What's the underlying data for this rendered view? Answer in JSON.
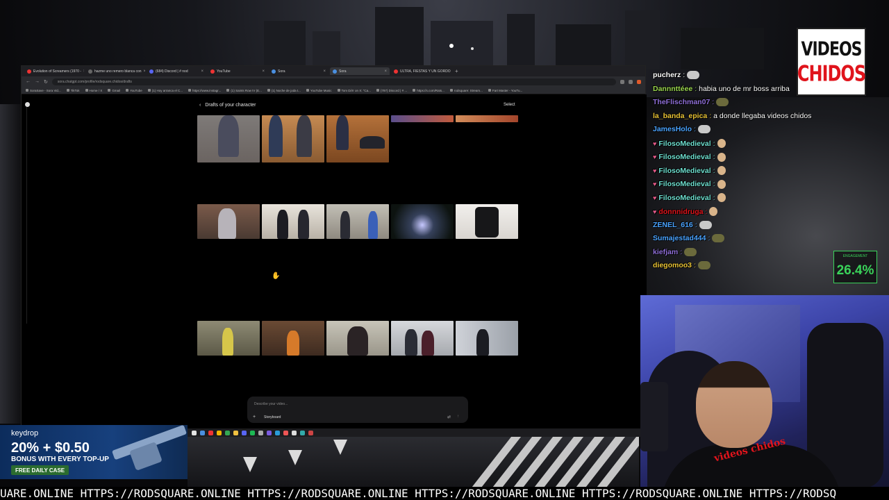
{
  "browser": {
    "tabs": [
      {
        "label": "Evolution of Screamers (1970 -",
        "active": false
      },
      {
        "label": "hazme uno remero blanca con",
        "active": false
      },
      {
        "label": "(684) Discord | # nod",
        "active": false
      },
      {
        "label": "YouTube",
        "active": false
      },
      {
        "label": "Sora",
        "active": false
      },
      {
        "label": "Sora",
        "active": true
      },
      {
        "label": "ULTRA, FIESTAS Y UN GORDO",
        "active": false
      }
    ],
    "url": "sora.chatgpt.com/profile/rodsquare.chidos/drafts",
    "bookmarks": [
      "SoraSave - Sora Vid...",
      "TikTok",
      "Home / X",
      "Gmail",
      "YouTube",
      "(1) Hoy arranca el C...",
      "https://www.instagr...",
      "(1) Saints Row IV (E...",
      "(1) Noche de joda t...",
      "YouTube Music",
      "Tom Di/rr on X: \"Ca...",
      "(787) Discord | # ...",
      "https://x.com/Rats...",
      "rodsquare: Stream...",
      "Fart Master - YouTu..."
    ]
  },
  "page": {
    "title": "Drafts of your character",
    "back_icon": "‹",
    "select_label": "Select",
    "composer_placeholder": "Describe your video...",
    "composer_storyboard": "Storyboard",
    "composer_plus": "+"
  },
  "chat": [
    {
      "user": "pucherz",
      "color": "#ffffff",
      "text": "",
      "heart": false,
      "emote": "gray"
    },
    {
      "user": "Dannnttéee",
      "color": "#9ad64e",
      "text": "habia uno de mr boss arriba",
      "heart": false,
      "emote": "none"
    },
    {
      "user": "TheFlischman07",
      "color": "#8f6fd8",
      "text": "",
      "heart": false,
      "emote": "green"
    },
    {
      "user": "la_banda_epica",
      "color": "#e8c235",
      "text": "a donde llegaba videos chidos",
      "heart": false,
      "emote": "none"
    },
    {
      "user": "JamesHolo",
      "color": "#4aa3ff",
      "text": "",
      "heart": false,
      "emote": "gray"
    },
    {
      "user": "FilosoMedieval",
      "color": "#6ee0d0",
      "text": "",
      "heart": true,
      "emote": "face"
    },
    {
      "user": "FilosoMedieval",
      "color": "#6ee0d0",
      "text": "",
      "heart": true,
      "emote": "face"
    },
    {
      "user": "FilosoMedieval",
      "color": "#6ee0d0",
      "text": "",
      "heart": true,
      "emote": "face"
    },
    {
      "user": "FilosoMedieval",
      "color": "#6ee0d0",
      "text": "",
      "heart": true,
      "emote": "face"
    },
    {
      "user": "FilosoMedieval",
      "color": "#6ee0d0",
      "text": "",
      "heart": true,
      "emote": "face"
    },
    {
      "user": "donnnidruga",
      "color": "#e0141c",
      "text": "",
      "heart": true,
      "emote": "face"
    },
    {
      "user": "ZENEL_616",
      "color": "#4aa3ff",
      "text": "",
      "heart": false,
      "emote": "gray"
    },
    {
      "user": "Sumajestad444",
      "color": "#4aa3ff",
      "text": "",
      "heart": false,
      "emote": "green"
    },
    {
      "user": "kiefjam",
      "color": "#8f6fd8",
      "text": "",
      "heart": false,
      "emote": "green"
    },
    {
      "user": "diegomoo3",
      "color": "#e8c235",
      "text": "",
      "heart": false,
      "emote": "green"
    }
  ],
  "logo": {
    "line1": "VIDEOS",
    "line2": "CHIDOS"
  },
  "engagement": {
    "label": "ENGAGEMENT",
    "value": "26.4%"
  },
  "ad": {
    "brand": "keydrop",
    "headline": "20% + $0.50",
    "subline": "BONUS WITH EVERY TOP-UP",
    "cta": "FREE DAILY CASE"
  },
  "webcam": {
    "overlay_text": "videos chidos"
  },
  "ticker": "UARE.ONLINE HTTPS://RODSQUARE.ONLINE HTTPS://RODSQUARE.ONLINE HTTPS://RODSQUARE.ONLINE HTTPS://RODSQUARE.ONLINE HTTPS://RODSQ",
  "colors": {
    "engagement": "#3ad35a",
    "brand_red": "#e0141c"
  }
}
